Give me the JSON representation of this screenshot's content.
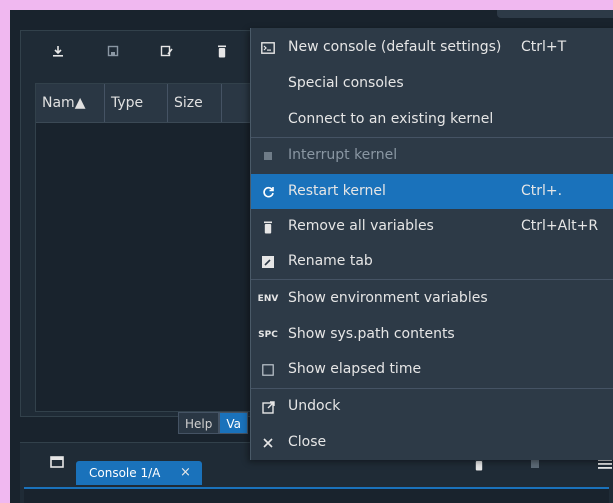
{
  "variable_explorer": {
    "columns": [
      "Nam▲",
      "Type",
      "Size"
    ],
    "bottom_tabs": [
      "Help",
      "Va"
    ]
  },
  "console": {
    "tab_label": "Console 1/A",
    "tab_close": "×"
  },
  "menu": {
    "items": [
      {
        "icon": "terminal-icon",
        "label": "New console (default settings)",
        "shortcut": "Ctrl+T"
      },
      {
        "icon": "",
        "label": "Special consoles",
        "submenu_arrow": "▶"
      },
      {
        "icon": "",
        "label": "Connect to an existing kernel"
      },
      {
        "icon": "stop-icon",
        "label": "Interrupt kernel",
        "disabled": true
      },
      {
        "icon": "restart-icon",
        "label": "Restart kernel",
        "shortcut": "Ctrl+.",
        "highlighted": true
      },
      {
        "icon": "trash-icon",
        "label": "Remove all variables",
        "shortcut": "Ctrl+Alt+R"
      },
      {
        "icon": "rename-icon",
        "label": "Rename tab"
      },
      {
        "icon": "env-icon",
        "icon_text": "ENV",
        "label": "Show environment variables"
      },
      {
        "icon": "spc-icon",
        "icon_text": "SPC",
        "label": "Show sys.path contents"
      },
      {
        "icon": "checkbox-icon",
        "label": "Show elapsed time"
      },
      {
        "icon": "undock-icon",
        "label": "Undock"
      },
      {
        "icon": "close-icon",
        "label": "Close"
      }
    ]
  },
  "colors": {
    "background": "#19232d",
    "menu_background": "#2d3a47",
    "accent": "#1a72bb",
    "frame": "#f0b8f0"
  }
}
